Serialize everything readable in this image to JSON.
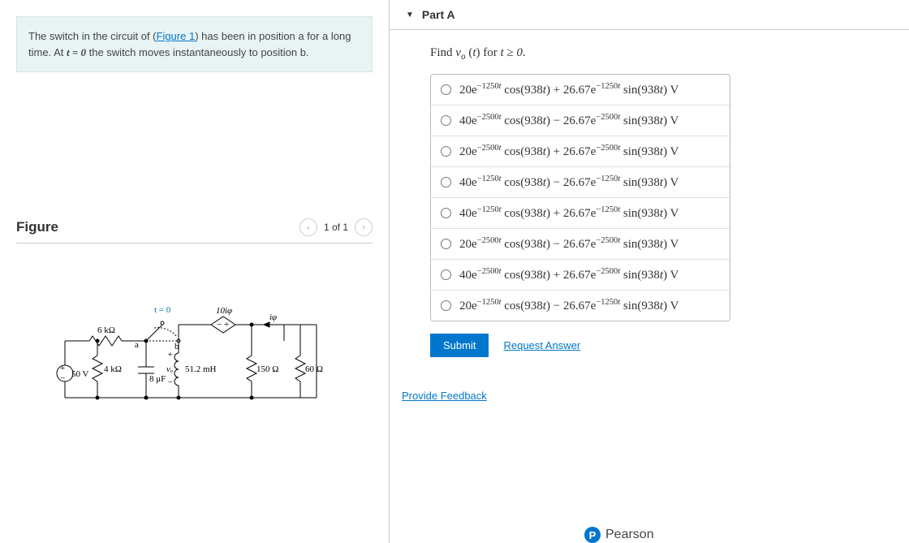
{
  "problem": {
    "pre": "The switch in the circuit of (",
    "figure_link": "Figure 1",
    "post": ") has been in position a for a long time. At ",
    "math": "t = 0",
    "tail": " the switch moves instantaneously to position b."
  },
  "figure": {
    "heading": "Figure",
    "pager": "1 of 1",
    "labels": {
      "t0": "t = 0",
      "r6k": "6 kΩ",
      "v50": "50 V",
      "r4k": "4 kΩ",
      "c8uf": "8 μF",
      "vo": "vₒ",
      "l512": "51.2 mH",
      "r150": "150 Ω",
      "r60": "60 Ω",
      "tenI": "10iφ",
      "iphi": "iφ",
      "a": "a",
      "b": "b"
    }
  },
  "part": {
    "arrow": "▼",
    "title": "Part A"
  },
  "question": {
    "find": "Find ",
    "vo_html": "v<span class='sub'>o</span> (t)",
    "for": " for ",
    "cond": "t ≥ 0",
    "dot": "."
  },
  "options": [
    {
      "a": "20",
      "e": "−1250",
      "sign": "+",
      "b": "26.67",
      "e2": "−1250"
    },
    {
      "a": "40",
      "e": "−2500",
      "sign": "−",
      "b": "26.67",
      "e2": "−2500"
    },
    {
      "a": "20",
      "e": "−2500",
      "sign": "+",
      "b": "26.67",
      "e2": "−2500"
    },
    {
      "a": "40",
      "e": "−1250",
      "sign": "−",
      "b": "26.67",
      "e2": "−1250"
    },
    {
      "a": "40",
      "e": "−1250",
      "sign": "+",
      "b": "26.67",
      "e2": "−1250"
    },
    {
      "a": "20",
      "e": "−2500",
      "sign": "−",
      "b": "26.67",
      "e2": "−2500"
    },
    {
      "a": "40",
      "e": "−2500",
      "sign": "+",
      "b": "26.67",
      "e2": "−2500"
    },
    {
      "a": "20",
      "e": "−1250",
      "sign": "−",
      "b": "26.67",
      "e2": "−1250"
    }
  ],
  "option_parts": {
    "e_letter": "e",
    "cos_pre": " cos(938",
    "t": "t",
    "cos_post": ") ",
    "sin_pre": " sin(938",
    "sin_post": ") V"
  },
  "buttons": {
    "submit": "Submit",
    "request": "Request Answer",
    "feedback": "Provide Feedback"
  },
  "footer": {
    "p": "P",
    "brand": "Pearson"
  }
}
